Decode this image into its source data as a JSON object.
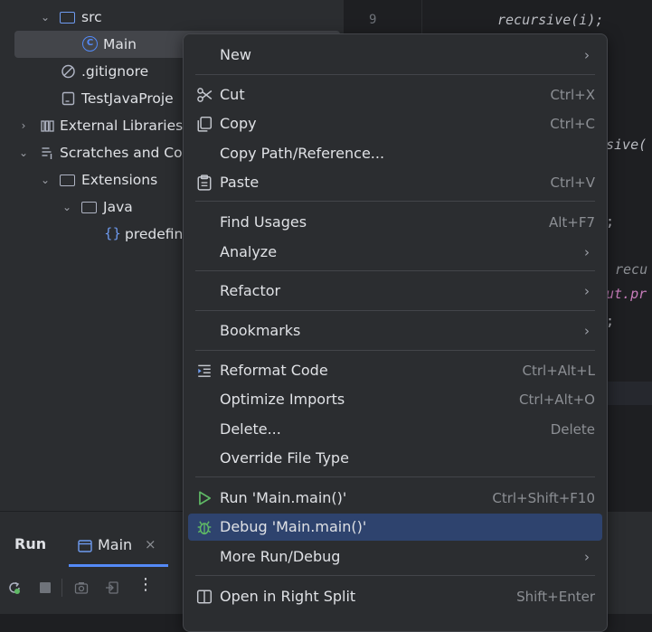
{
  "tree": {
    "items": [
      {
        "label": "src",
        "icon": "folder-icon"
      },
      {
        "label": "Main",
        "icon": "java-class-icon"
      },
      {
        "label": ".gitignore",
        "icon": "ignore-file-icon"
      },
      {
        "label": "TestJavaProje",
        "icon": "file-icon"
      },
      {
        "label": "External Libraries",
        "icon": "library-icon"
      },
      {
        "label": "Scratches and Co",
        "icon": "scratches-icon"
      },
      {
        "label": "Extensions",
        "icon": "folder-icon"
      },
      {
        "label": "Java",
        "icon": "folder-icon"
      },
      {
        "label": "predefin",
        "icon": "json-icon"
      }
    ]
  },
  "editor": {
    "line_numbers": [
      "9"
    ],
    "code_lines": [
      "recursive(i);",
      "sive(",
      ";",
      "recu",
      "ut.pr",
      ";"
    ]
  },
  "run_panel": {
    "title": "Run",
    "tab_label": "Main"
  },
  "menu": {
    "items": [
      {
        "label": "New",
        "shortcut": "",
        "submenu": true
      },
      {
        "label": "Cut",
        "shortcut": "Ctrl+X",
        "icon": "scissors-icon"
      },
      {
        "label": "Copy",
        "shortcut": "Ctrl+C",
        "icon": "copy-icon"
      },
      {
        "label": "Copy Path/Reference...",
        "shortcut": ""
      },
      {
        "label": "Paste",
        "shortcut": "Ctrl+V",
        "icon": "paste-icon"
      },
      {
        "label": "Find Usages",
        "shortcut": "Alt+F7"
      },
      {
        "label": "Analyze",
        "shortcut": "",
        "submenu": true
      },
      {
        "label": "Refactor",
        "shortcut": "",
        "submenu": true
      },
      {
        "label": "Bookmarks",
        "shortcut": "",
        "submenu": true
      },
      {
        "label": "Reformat Code",
        "shortcut": "Ctrl+Alt+L",
        "icon": "reformat-icon"
      },
      {
        "label": "Optimize Imports",
        "shortcut": "Ctrl+Alt+O"
      },
      {
        "label": "Delete...",
        "shortcut": "Delete"
      },
      {
        "label": "Override File Type",
        "shortcut": ""
      },
      {
        "label": "Run 'Main.main()'",
        "shortcut": "Ctrl+Shift+F10",
        "icon": "run-icon"
      },
      {
        "label": "Debug 'Main.main()'",
        "shortcut": "",
        "icon": "debug-icon",
        "selected": true
      },
      {
        "label": "More Run/Debug",
        "shortcut": "",
        "submenu": true
      },
      {
        "label": "Open in Right Split",
        "shortcut": "Shift+Enter",
        "icon": "split-icon"
      }
    ]
  },
  "colors": {
    "selection": "#2e436e",
    "accent": "#548af7",
    "run_green": "#5fb865"
  }
}
